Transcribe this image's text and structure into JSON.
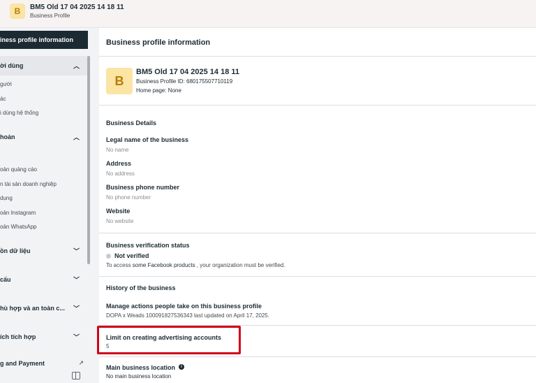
{
  "header": {
    "avatar_letter": "B",
    "business_name": "BM5 Old 17 04 2025 14 18 11",
    "subtitle": "Business Profile"
  },
  "sidebar": {
    "active_item": "iness profile information",
    "groups": [
      {
        "label": "ời dùng",
        "expanded": true,
        "items": [
          "gười",
          "ác",
          "i dùng hệ thống"
        ]
      },
      {
        "label": "hoản",
        "expanded": true,
        "items": [
          "",
          "oản quảng cáo",
          "n tài sản doanh nghiệp",
          "dụng",
          "oản Instagram",
          "oản WhatsApp"
        ]
      },
      {
        "label": "ồn dữ liệu",
        "expanded": false,
        "items": []
      },
      {
        "label": "cấu",
        "expanded": false,
        "items": []
      },
      {
        "label": "hù hợp và an toàn c...",
        "expanded": false,
        "items": []
      },
      {
        "label": "ích tích hợp",
        "expanded": false,
        "items": []
      },
      {
        "label": "g and Payment",
        "expanded": false,
        "items": []
      }
    ]
  },
  "main": {
    "title": "Business profile information",
    "profile": {
      "avatar_letter": "B",
      "name": "BM5 Old 17 04 2025 14 18 11",
      "id_line": "Business Profile ID: 680175507710119",
      "homepage_line": "Home page: None"
    },
    "details": {
      "title": "Business Details",
      "fields": [
        {
          "label": "Legal name of the business",
          "value": "No name"
        },
        {
          "label": "Address",
          "value": "No address"
        },
        {
          "label": "Business phone number",
          "value": "No phone number"
        },
        {
          "label": "Website",
          "value": "No website"
        }
      ]
    },
    "verification": {
      "title": "Business verification status",
      "status": "Not verified",
      "note_prefix": "To access ",
      "note_link": "some Facebook products",
      "note_suffix": " , your organization must be verified."
    },
    "history": {
      "title": "History of the business",
      "subtitle": "Manage actions people take on this business profile",
      "meta": "DOPA x Weads 100091827536343 last updated on April 17, 2025."
    },
    "limit": {
      "title": "Limit on creating advertising accounts",
      "value": "5"
    },
    "location": {
      "title": "Main business location",
      "value": "No main business location",
      "info_glyph": "i"
    }
  },
  "colors": {
    "highlight": "#d0021b",
    "avatar_bg": "#fbe4a4",
    "sidebar_active": "#1c2b33"
  }
}
